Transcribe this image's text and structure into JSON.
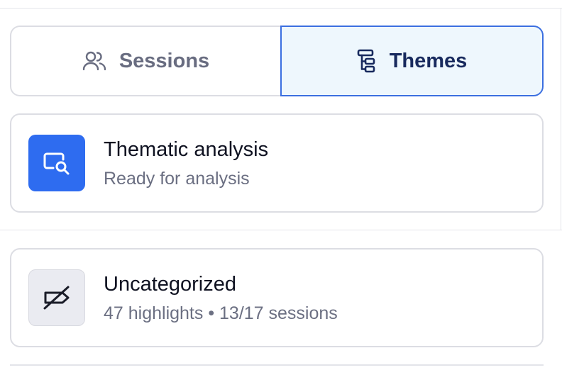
{
  "tabs": {
    "sessions": {
      "label": "Sessions",
      "icon": "users-icon"
    },
    "themes": {
      "label": "Themes",
      "icon": "theme-tree-icon",
      "selected": true
    }
  },
  "cards": [
    {
      "title": "Thematic analysis",
      "subtitle": "Ready for analysis",
      "icon": "search-chat-icon",
      "icon_bg": "#2e6cf0"
    },
    {
      "title": "Uncategorized",
      "subtitle": "47 highlights • 13/17 sessions",
      "icon": "tag-off-icon",
      "icon_bg": "#eaebf1"
    }
  ],
  "colors": {
    "accent": "#3b6fe0",
    "accent_bg": "#eef7fd",
    "dark_text": "#182a5e"
  }
}
